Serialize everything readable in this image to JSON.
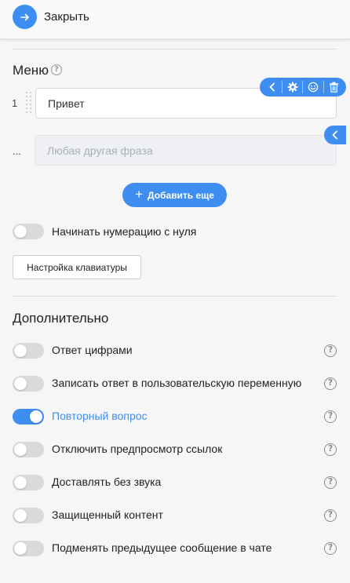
{
  "header": {
    "close_label": "Закрыть"
  },
  "menu": {
    "title": "Меню",
    "items": [
      {
        "number": "1",
        "value": "Привет"
      }
    ],
    "extra_row": {
      "number": "...",
      "placeholder": "Любая другая фраза"
    },
    "add_button_label": "Добавить еще",
    "numbering_toggle": {
      "label": "Начинать нумерацию с нуля",
      "on": false
    },
    "keyboard_button_label": "Настройка клавиатуры"
  },
  "additional": {
    "title": "Дополнительно",
    "options": [
      {
        "label": "Ответ цифрами",
        "on": false
      },
      {
        "label": "Записать ответ в пользовательскую переменную",
        "on": false
      },
      {
        "label": "Повторный вопрос",
        "on": true
      },
      {
        "label": "Отключить предпросмотр ссылок",
        "on": false
      },
      {
        "label": "Доставлять без звука",
        "on": false
      },
      {
        "label": "Защищенный контент",
        "on": false
      },
      {
        "label": "Подменять предыдущее сообщение в чате",
        "on": false
      }
    ]
  },
  "colors": {
    "accent": "#3d8ef0",
    "toggle_off": "#dadada",
    "background": "#f6f6f6"
  },
  "icons": {
    "close": "arrow-right-icon",
    "toolbar": [
      "chevron-left-icon",
      "gear-icon",
      "smiley-icon",
      "trash-icon"
    ],
    "collapse": "chevron-left-icon",
    "help": "question-circle-icon"
  }
}
